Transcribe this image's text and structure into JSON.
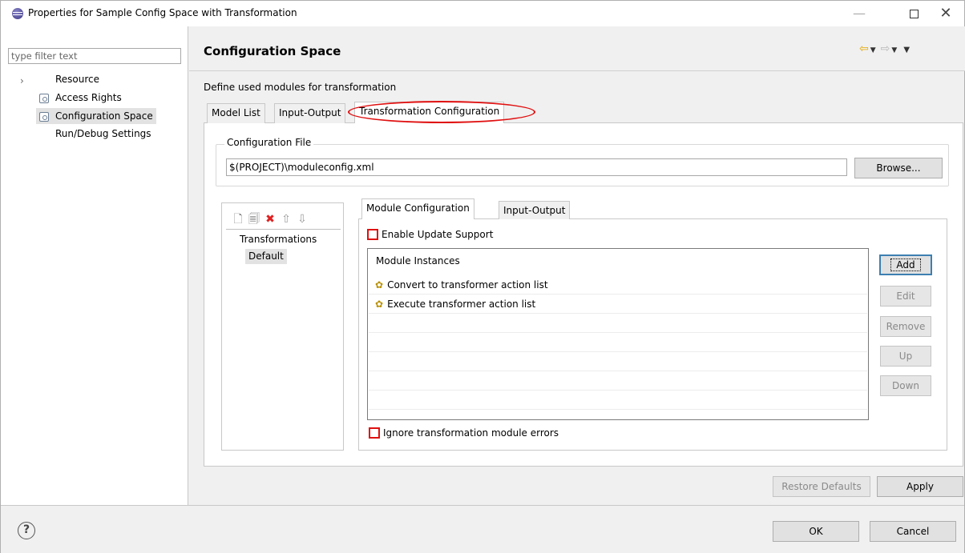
{
  "window": {
    "title": "Properties for Sample Config Space with Transformation"
  },
  "filter": {
    "placeholder": "type filter text"
  },
  "tree": {
    "items": [
      {
        "label": "Resource"
      },
      {
        "label": "Access Rights"
      },
      {
        "label": "Configuration Space"
      },
      {
        "label": "Run/Debug Settings"
      }
    ]
  },
  "page": {
    "title": "Configuration Space",
    "description": "Define used modules for transformation"
  },
  "outer_tabs": [
    {
      "label": "Model List"
    },
    {
      "label": "Input-Output"
    },
    {
      "label": "Transformation Configuration"
    }
  ],
  "config_file": {
    "legend": "Configuration File",
    "value": "$(PROJECT)\\moduleconfig.xml",
    "browse_label": "Browse..."
  },
  "transformations": {
    "heading": "Transformations",
    "items": [
      {
        "label": "Default"
      }
    ]
  },
  "inner_tabs": [
    {
      "label": "Module Configuration"
    },
    {
      "label": "Input-Output"
    }
  ],
  "options": {
    "enable_update": "Enable Update Support",
    "ignore_errors": "Ignore transformation module errors"
  },
  "modules": {
    "heading": "Module Instances",
    "rows": [
      {
        "label": "Convert to transformer action list"
      },
      {
        "label": "Execute transformer action list"
      }
    ]
  },
  "side_buttons": {
    "add": "Add",
    "edit": "Edit",
    "remove": "Remove",
    "up": "Up",
    "down": "Down"
  },
  "footer": {
    "restore_defaults": "Restore Defaults",
    "apply": "Apply",
    "ok": "OK",
    "cancel": "Cancel"
  },
  "colors": {
    "accent_highlight": "#e01010",
    "selection": "#e2e2e2",
    "nav_back": "#e5a800"
  }
}
